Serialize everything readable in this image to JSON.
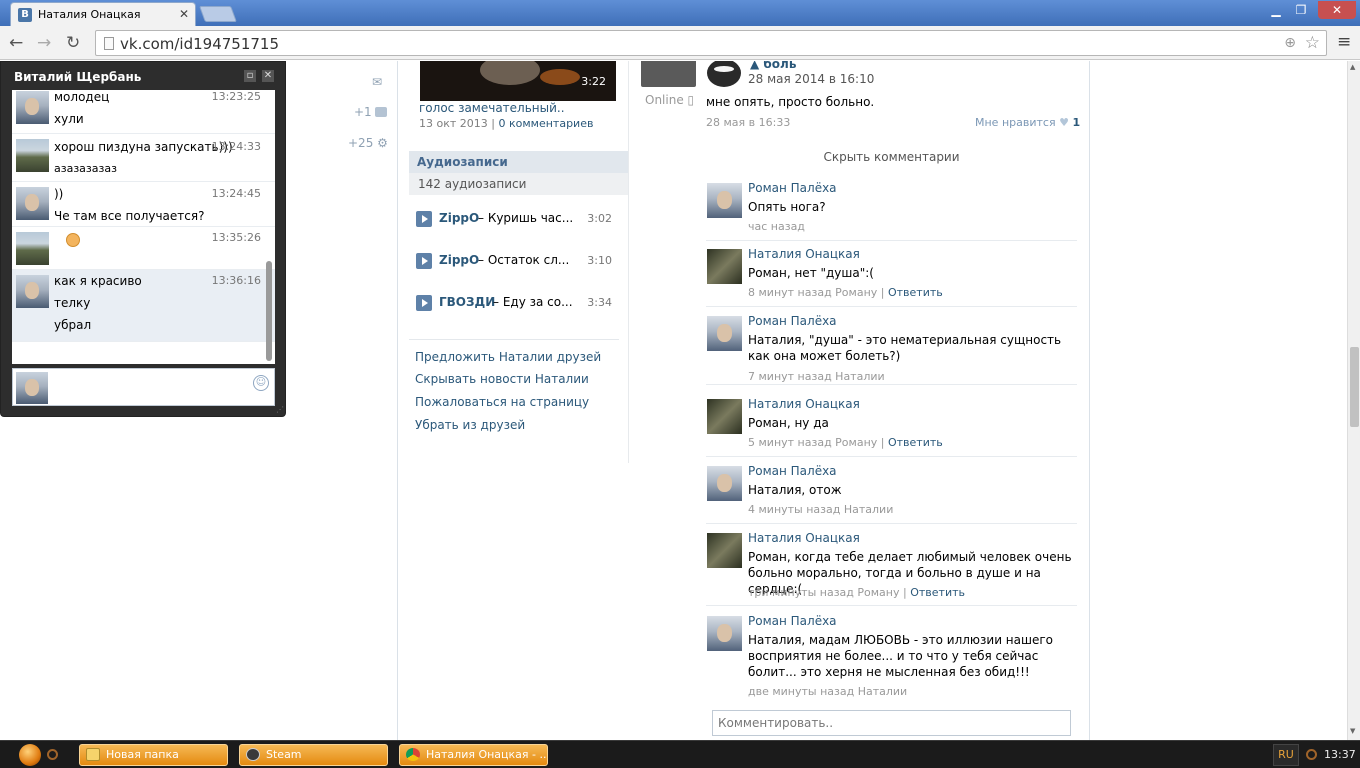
{
  "browser": {
    "tab_title": "Наталия Онацкая",
    "tab_favicon": "В",
    "url": "vk.com/id194751715"
  },
  "chat": {
    "title": "Виталий Щербань",
    "messages": [
      {
        "lines": [
          "молодец",
          "хули"
        ],
        "time": "13:23:25",
        "avatar": "roman"
      },
      {
        "lines": [
          "хорош пиздуна запускать)))",
          "азазазазаз"
        ],
        "time": "13:24:33",
        "avatar": "lake"
      },
      {
        "lines": [
          "))",
          "Че там все получается?"
        ],
        "time": "13:24:45",
        "avatar": "roman"
      },
      {
        "lines": [
          ""
        ],
        "time": "13:35:26",
        "avatar": "lake",
        "emoji": "ok-hand-emoji"
      },
      {
        "lines": [
          "как я красиво",
          "телку",
          "убрал"
        ],
        "time": "13:36:16",
        "avatar": "roman"
      }
    ]
  },
  "side_counters": {
    "likes": "+1",
    "gifts": "+25"
  },
  "video": {
    "duration": "3:22",
    "title": "голос замечательный..",
    "date": "13 окт 2013",
    "separator": "|",
    "comments": "0 комментариев"
  },
  "audio": {
    "header": "Аудиозаписи",
    "count": "142 аудиозаписи",
    "tracks": [
      {
        "artist": "ZippO",
        "song": "– Куришь час...",
        "time": "3:02"
      },
      {
        "artist": "ZippO",
        "song": "– Остаток сл...",
        "time": "3:10"
      },
      {
        "artist": "ГВОЗДИ",
        "song": "– Еду за со...",
        "time": "3:34"
      }
    ]
  },
  "profile_actions": [
    "Предложить Наталии друзей",
    "Скрывать новости Наталии",
    "Пожаловаться на страницу",
    "Убрать из друзей"
  ],
  "owner": {
    "online": "Online"
  },
  "post": {
    "author": "боль",
    "date": "28 мая 2014 в 16:10",
    "text": "мне опять, просто больно.",
    "meta": "28 мая в 16:33",
    "like_label": "Мне нравится",
    "like_count": "1",
    "hide_comments": "Скрыть комментарии",
    "comment_placeholder": "Комментировать.."
  },
  "comments": [
    {
      "author": "Роман Палёха",
      "avatar": "roman",
      "text": "Опять нога?",
      "meta": "час назад",
      "reply": ""
    },
    {
      "author": "Наталия Онацкая",
      "avatar": "natalia",
      "text": "Роман, нет \"душа\":(",
      "meta": "8 минут назад Роману",
      "reply": "Ответить"
    },
    {
      "author": "Роман Палёха",
      "avatar": "roman",
      "text": "Наталия, \"душа\" - это нематериальная сущность как она может болеть?)",
      "meta": "7 минут назад Наталии",
      "reply": ""
    },
    {
      "author": "Наталия Онацкая",
      "avatar": "natalia",
      "text": "Роман, ну да",
      "meta": "5 минут назад Роману",
      "reply": "Ответить"
    },
    {
      "author": "Роман Палёха",
      "avatar": "roman",
      "text": "Наталия, отож",
      "meta": "4 минуты назад Наталии",
      "reply": ""
    },
    {
      "author": "Наталия Онацкая",
      "avatar": "natalia",
      "text": "Роман, когда тебе делает любимый человек очень больно морально, тогда и больно в душе и на сердце:(",
      "meta": "три минуты назад Роману",
      "reply": "Ответить"
    },
    {
      "author": "Роман Палёха",
      "avatar": "roman",
      "text": "Наталия, мадам ЛЮБОВЬ - это иллюзии нашего восприятия не более... и то что у тебя сейчас болит... это херня не мысленная без обид!!!",
      "meta": "две минуты назад Наталии",
      "reply": ""
    }
  ],
  "taskbar": {
    "tasks": [
      "Новая папка",
      "Steam",
      "Наталия Онацкая - ..."
    ],
    "lang": "RU",
    "clock": "13:37"
  },
  "colors": {
    "link": "#2b587a",
    "accent_orange": "#e48a10",
    "chrome_title": "#4a7ac1"
  }
}
